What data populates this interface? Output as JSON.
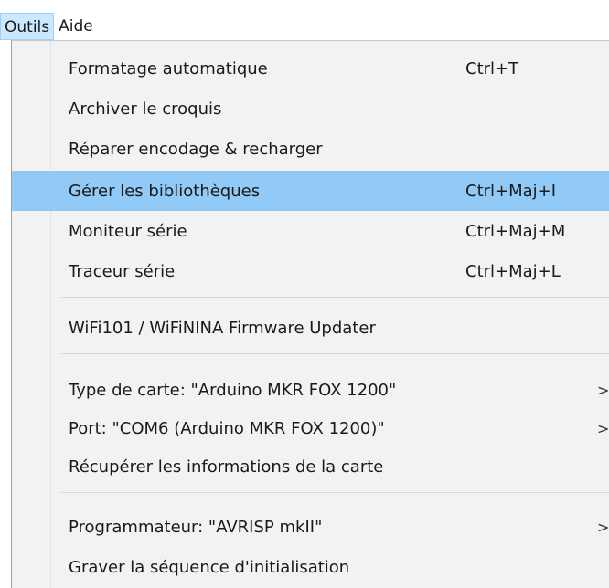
{
  "menubar": {
    "items": [
      {
        "label": "Outils"
      },
      {
        "label": "Aide"
      }
    ]
  },
  "menu": {
    "items": [
      {
        "label": "Formatage automatique",
        "shortcut": "Ctrl+T"
      },
      {
        "label": "Archiver le croquis",
        "shortcut": ""
      },
      {
        "label": "Réparer encodage & recharger",
        "shortcut": ""
      },
      {
        "label": "Gérer les bibliothèques",
        "shortcut": "Ctrl+Maj+I"
      },
      {
        "label": "Moniteur série",
        "shortcut": "Ctrl+Maj+M"
      },
      {
        "label": "Traceur série",
        "shortcut": "Ctrl+Maj+L"
      },
      {
        "label": "WiFi101 / WiFiNINA Firmware Updater",
        "shortcut": ""
      },
      {
        "label": "Type de carte: \"Arduino MKR FOX 1200\"",
        "shortcut": "",
        "submenu": ">"
      },
      {
        "label": "Port: \"COM6 (Arduino MKR FOX 1200)\"",
        "shortcut": "",
        "submenu": ">"
      },
      {
        "label": "Récupérer les informations de la carte",
        "shortcut": ""
      },
      {
        "label": "Programmateur: \"AVRISP mkII\"",
        "shortcut": "",
        "submenu": ">"
      },
      {
        "label": "Graver la séquence d'initialisation",
        "shortcut": ""
      }
    ]
  }
}
